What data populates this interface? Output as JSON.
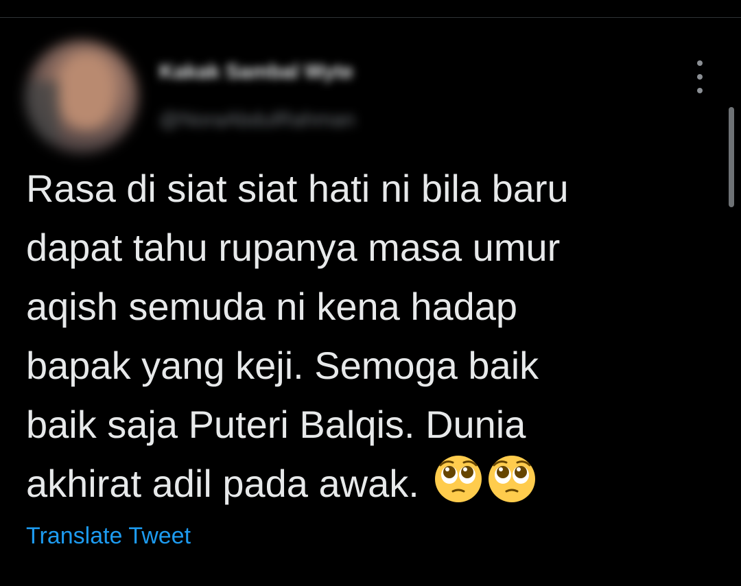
{
  "tweet": {
    "author_display_name": "Kakak Sambal Wyte",
    "author_handle": "@NoraAbdulRahman",
    "text_lines": [
      "Rasa di siat siat hati ni bila baru",
      "dapat tahu rupanya masa umur",
      "aqish semuda ni kena hadap",
      "bapak yang keji. Semoga baik",
      "baik saja Puteri Balqis. Dunia",
      "akhirat adil pada awak."
    ],
    "emojis": [
      "pleading-face-emoji",
      "pleading-face-emoji"
    ],
    "translate_label": "Translate Tweet",
    "more_icon": "more-vertical-icon"
  },
  "colors": {
    "background": "#000000",
    "text": "#e7e9ea",
    "secondary_text": "#71767b",
    "link": "#1d9bf0",
    "emoji_yellow": "#ffcc4d"
  }
}
